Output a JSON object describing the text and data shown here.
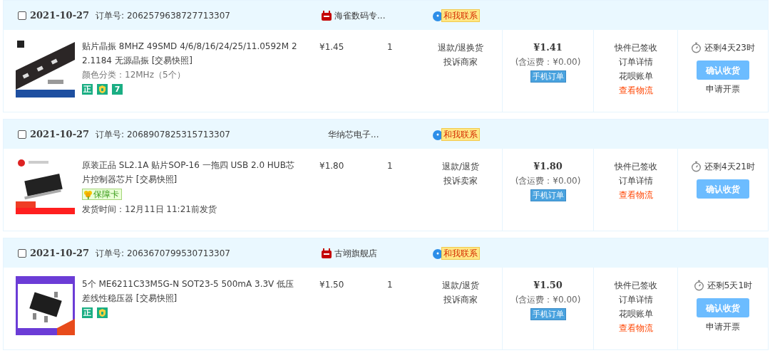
{
  "orders": [
    {
      "checked": false,
      "date": "2021-10-27",
      "order_no_label": "订单号:",
      "order_no": "2062579638727713307",
      "shop": {
        "name": "海雀数码专...",
        "tmall": true
      },
      "contact": "和我联系",
      "title": "贴片晶振 8MHZ 49SMD 4/6/8/16/24/25/11.0592M 22.1184 无源晶振",
      "snapshot": "[交易快照]",
      "spec": "颜色分类：12MHz（5个）",
      "badges": [
        {
          "kind": "char",
          "text": "正"
        },
        {
          "kind": "shield"
        },
        {
          "kind": "char",
          "text": "7"
        }
      ],
      "price": "¥1.45",
      "qty": "1",
      "after_sales": [
        "退款/退换货",
        "投诉商家"
      ],
      "total": "¥1.41",
      "shipping": "(含运费：¥0.00)",
      "mobile_tag": "手机订单",
      "status_links": [
        {
          "text": "快件已签收",
          "highlight": false
        },
        {
          "text": "订单详情",
          "highlight": false
        },
        {
          "text": "花呗账单",
          "highlight": false
        },
        {
          "text": "查看物流",
          "highlight": true
        }
      ],
      "countdown": "还剩4天23时",
      "confirm": "确认收货",
      "invoice": "申请开票"
    },
    {
      "checked": false,
      "date": "2021-10-27",
      "order_no_label": "订单号:",
      "order_no": "2068907825315713307",
      "shop": {
        "name": "华纳芯电子...",
        "tmall": false
      },
      "contact": "和我联系",
      "title": "原装正品 SL2.1A 贴片SOP-16 一拖四 USB 2.0 HUB芯片控制器芯片",
      "snapshot": "[交易快照]",
      "badges": [
        {
          "kind": "card",
          "text": "保障卡"
        }
      ],
      "ship_time": "发货时间：12月11日 11:21前发货",
      "price": "¥1.80",
      "qty": "1",
      "after_sales": [
        "退款/退货",
        "投诉卖家"
      ],
      "total": "¥1.80",
      "shipping": "(含运费：¥0.00)",
      "mobile_tag": "手机订单",
      "status_links": [
        {
          "text": "快件已签收",
          "highlight": false
        },
        {
          "text": "订单详情",
          "highlight": false
        },
        {
          "text": "查看物流",
          "highlight": true
        }
      ],
      "countdown": "还剩4天21时",
      "confirm": "确认收货"
    },
    {
      "checked": false,
      "date": "2021-10-27",
      "order_no_label": "订单号:",
      "order_no": "2063670799530713307",
      "shop": {
        "name": "古翊旗舰店",
        "tmall": true
      },
      "contact": "和我联系",
      "title": "5个 ME6211C33M5G-N SOT23-5 500mA 3.3V 低压差线性稳压器",
      "snapshot": "[交易快照]",
      "badges": [
        {
          "kind": "char",
          "text": "正"
        },
        {
          "kind": "shield"
        }
      ],
      "price": "¥1.50",
      "qty": "1",
      "after_sales": [
        "退款/退货",
        "投诉商家"
      ],
      "total": "¥1.50",
      "shipping": "(含运费：¥0.00)",
      "mobile_tag": "手机订单",
      "status_links": [
        {
          "text": "快件已签收",
          "highlight": false
        },
        {
          "text": "订单详情",
          "highlight": false
        },
        {
          "text": "花呗账单",
          "highlight": false
        },
        {
          "text": "查看物流",
          "highlight": true
        }
      ],
      "countdown": "还剩5天1时",
      "confirm": "确认收货",
      "invoice": "申请开票"
    }
  ]
}
